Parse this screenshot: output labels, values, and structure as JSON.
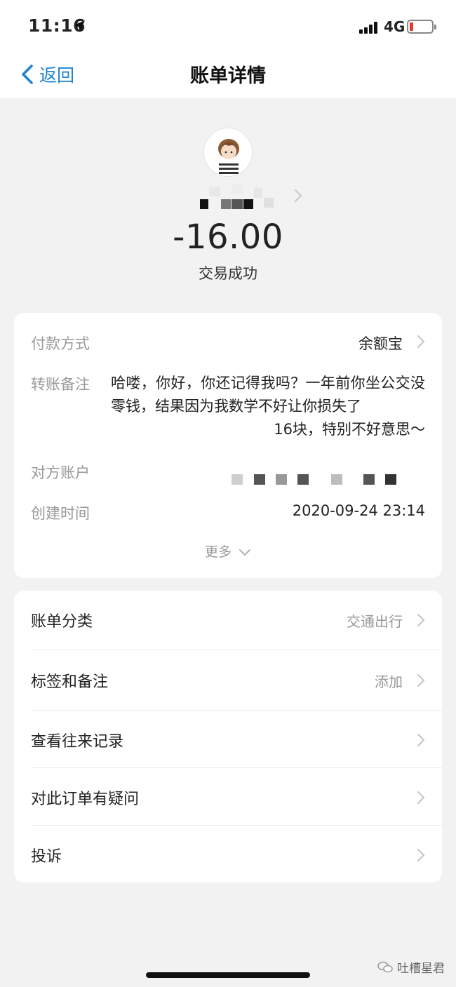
{
  "status_bar": {
    "time": "11:16",
    "network": "4G"
  },
  "nav": {
    "back_label": "返回",
    "title": "账单详情"
  },
  "header": {
    "amount": "-16.00",
    "status": "交易成功"
  },
  "details": {
    "payment_method_label": "付款方式",
    "payment_method_value": "余额宝",
    "memo_label": "转账备注",
    "memo_line1": "哈喽，你好，你还记得我吗？一年前你坐公交没零钱，结果因为我数学不好让你损失了",
    "memo_line2": "16块，特别不好意思～",
    "account_label": "对方账户",
    "created_label": "创建时间",
    "created_value": "2020-09-24 23:14",
    "more_label": "更多"
  },
  "actions": [
    {
      "label": "账单分类",
      "value": "交通出行"
    },
    {
      "label": "标签和备注",
      "value": "添加"
    },
    {
      "label": "查看往来记录",
      "value": ""
    },
    {
      "label": "对此订单有疑问",
      "value": ""
    },
    {
      "label": "投诉",
      "value": ""
    }
  ],
  "watermark": {
    "text": "吐槽星君"
  },
  "icons": [
    "location-arrow-icon",
    "signal-icon",
    "battery-icon",
    "back-chevron-icon",
    "chevron-right-icon",
    "chevron-down-icon",
    "wechat-icon"
  ],
  "colors": {
    "accent": "#1e82d2",
    "muted": "#999999",
    "battery_low": "#e53935",
    "background": "#f2f2f2"
  }
}
